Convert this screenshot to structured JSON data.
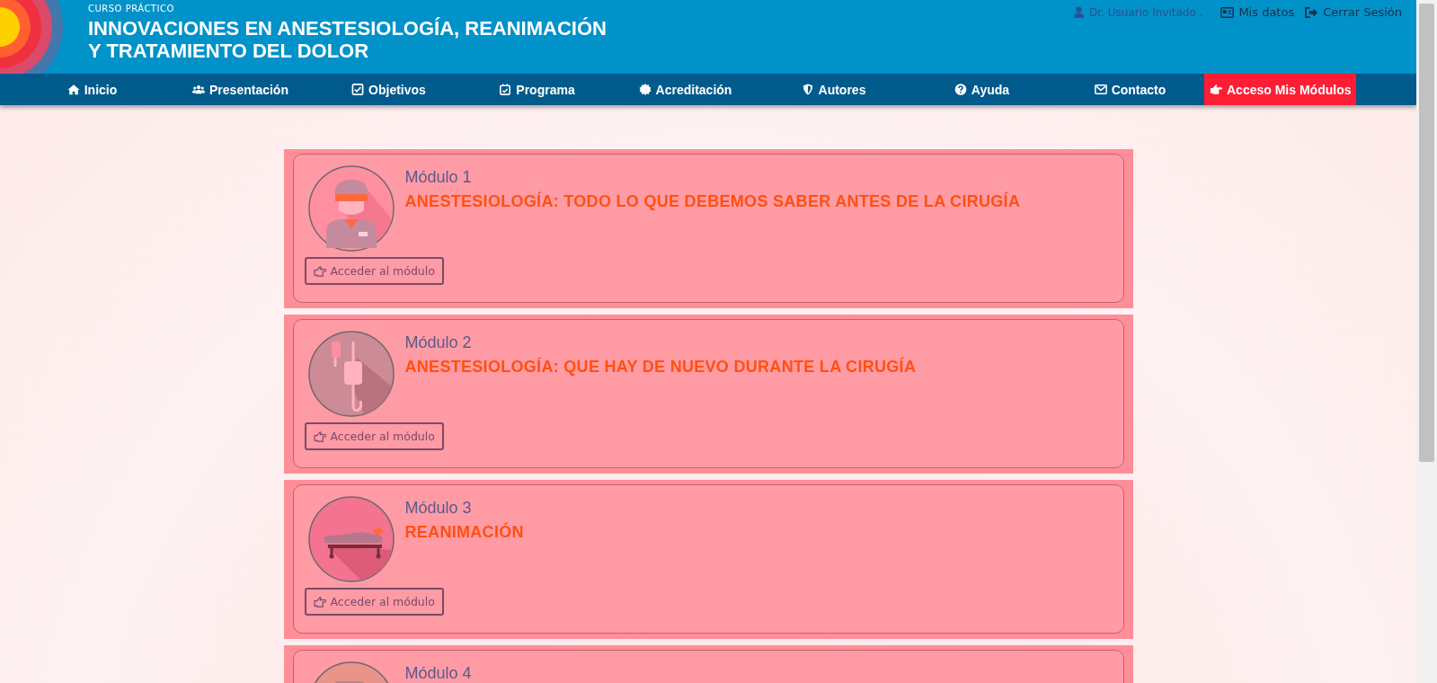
{
  "header": {
    "kicker": "CURSO PRÁCTICO",
    "title_line_1": "INNOVACIONES EN ANESTESIOLOGÍA, REANIMACIÓN",
    "title_line_2": "Y TRATAMIENTO DEL DOLOR"
  },
  "user_bar": {
    "user": "Dr. Usuario Invitado .",
    "links": [
      {
        "kind": "card",
        "label": "Mis datos"
      },
      {
        "kind": "exit",
        "label": "Cerrar Sesión"
      }
    ]
  },
  "nav": [
    {
      "kind": "home",
      "label": "Inicio",
      "selected": false
    },
    {
      "kind": "users",
      "label": "Presentación",
      "selected": false
    },
    {
      "kind": "check",
      "label": "Objetivos",
      "selected": false
    },
    {
      "kind": "calendar",
      "label": "Programa",
      "selected": false
    },
    {
      "kind": "badge",
      "label": "Acreditación",
      "selected": false
    },
    {
      "kind": "shield",
      "label": "Autores",
      "selected": false
    },
    {
      "kind": "question",
      "label": "Ayuda",
      "selected": false
    },
    {
      "kind": "mail",
      "label": "Contacto",
      "selected": false
    },
    {
      "kind": "hand",
      "label": "Acceso Mis Módulos",
      "selected": true
    }
  ],
  "modules": [
    {
      "kind": "surgeon",
      "number": "Módulo 1",
      "title": "ANESTESIOLOGÍA: TODO LO QUE DEBEMOS SABER ANTES DE LA CIRUGÍA",
      "button": "Acceder al módulo"
    },
    {
      "kind": "drip",
      "number": "Módulo 2",
      "title": "ANESTESIOLOGÍA: QUE HAY DE NUEVO DURANTE LA CIRUGÍA",
      "button": "Acceder al módulo"
    },
    {
      "kind": "bed",
      "number": "Módulo 3",
      "title": "REANIMACIÓN",
      "button": "Acceder al módulo"
    },
    {
      "kind": "device",
      "number": "Módulo 4"
    }
  ]
}
